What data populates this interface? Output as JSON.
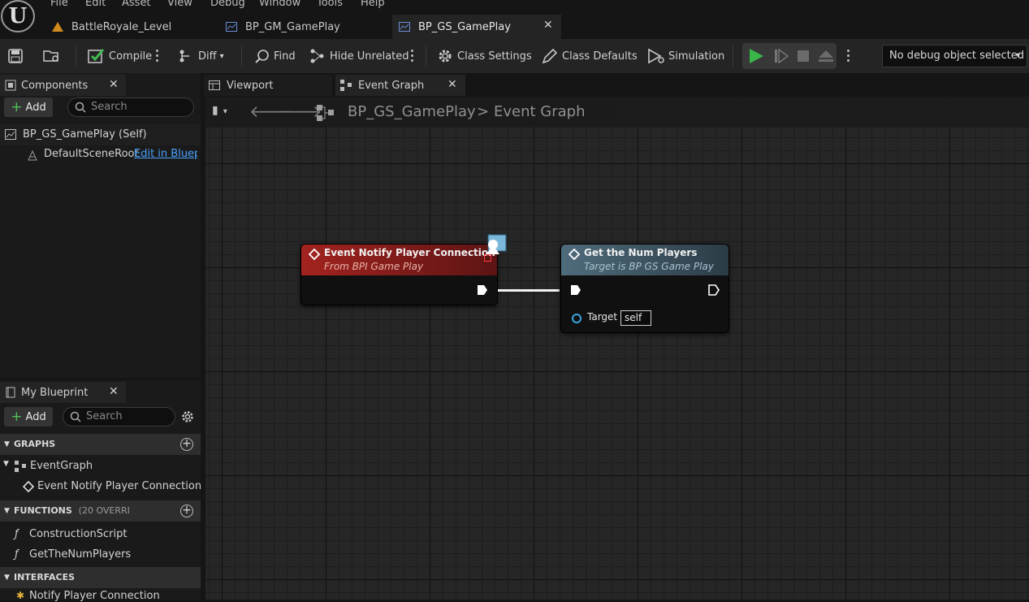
{
  "menu": [
    "File",
    "Edit",
    "Asset",
    "View",
    "Debug",
    "Window",
    "Tools",
    "Help"
  ],
  "logo": {
    "letter": "U"
  },
  "doc_tabs": [
    {
      "label": "BattleRoyale_Level",
      "icon": "level-icon"
    },
    {
      "label": "BP_GM_GamePlay",
      "icon": "blueprint-icon"
    },
    {
      "label": "BP_GS_GamePlay",
      "icon": "blueprint-icon",
      "active": true
    }
  ],
  "toolbar": {
    "compile": "Compile",
    "diff": "Diff",
    "find": "Find",
    "hide_unrelated": "Hide Unrelated",
    "class_settings": "Class Settings",
    "class_defaults": "Class Defaults",
    "simulation": "Simulation",
    "debug_object": "No debug object selected"
  },
  "components": {
    "tab": "Components",
    "add": "Add",
    "search_placeholder": "Search",
    "self": "BP_GS_GamePlay (Self)",
    "root": "DefaultSceneRoot",
    "edit_link": "Edit in Blueprint"
  },
  "editor_tabs": [
    {
      "label": "Viewport"
    },
    {
      "label": "Event Graph",
      "active": true
    }
  ],
  "breadcrumb": {
    "blueprint": "BP_GS_GamePlay",
    "separator": ">",
    "graph": "Event Graph"
  },
  "nodes": {
    "event": {
      "title": "Event Notify Player Connection",
      "subtitle": "From BPI Game Play",
      "header_color": "#8e1b1b"
    },
    "call": {
      "title": "Get the Num Players",
      "subtitle": "Target is BP GS Game Play",
      "header_color": "#3f5866",
      "pin_label": "Target",
      "pin_value": "self"
    }
  },
  "my_blueprint": {
    "tab": "My Blueprint",
    "add": "Add",
    "search_placeholder": "Search",
    "graphs_header": "GRAPHS",
    "graph_item": "EventGraph",
    "graph_event": "Event Notify Player Connection",
    "functions_header": "FUNCTIONS",
    "functions_note": "(20 OVERRI",
    "function_1": "ConstructionScript",
    "function_2": "GetTheNumPlayers",
    "interfaces_header": "INTERFACES",
    "interface_1": "Notify Player Connection"
  }
}
